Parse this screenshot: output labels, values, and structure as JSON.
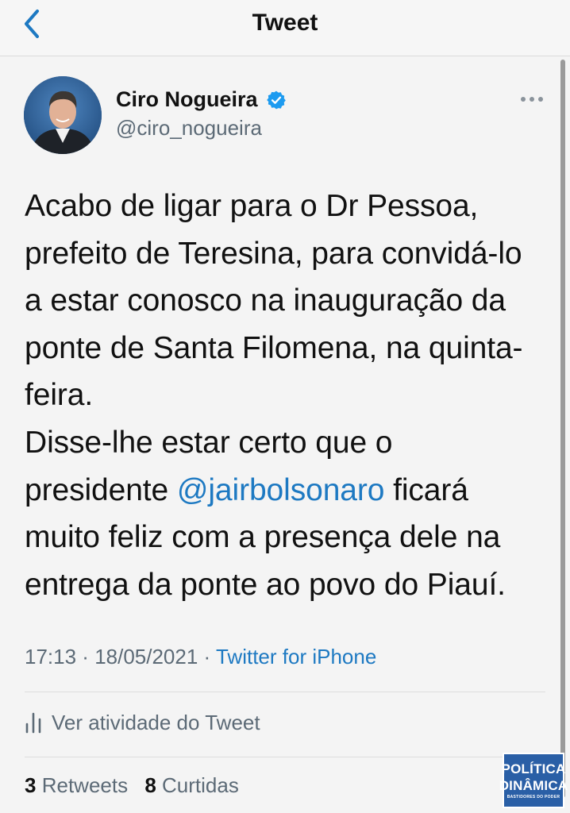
{
  "header": {
    "title": "Tweet"
  },
  "author": {
    "name": "Ciro Nogueira",
    "handle": "@ciro_nogueira"
  },
  "tweet": {
    "lines": [
      "Acabo de ligar para o Dr Pessoa,",
      "prefeito de Teresina, para convidá-lo",
      "a estar conosco na inauguração da",
      "ponte de Santa Filomena, na quinta-",
      "feira.",
      "Disse-lhe estar certo que o"
    ],
    "mention_prefix": "presidente ",
    "mention": "@jairbolsonaro",
    "mention_suffix": " ficará",
    "lines_after": [
      "muito feliz com a presença dele na",
      "entrega da ponte ao povo do Piauí."
    ]
  },
  "meta": {
    "time": "17:13",
    "separator": " · ",
    "date": "18/05/2021",
    "source": "Twitter for iPhone"
  },
  "activity": {
    "label": "Ver atividade do Tweet"
  },
  "stats": {
    "retweets_count": "3",
    "retweets_label": "Retweets",
    "likes_count": "8",
    "likes_label": "Curtidas"
  },
  "watermark": {
    "line1": "POLÍTICA",
    "line2": "DINÂMICA",
    "line3": "BASTIDORES DO PODER"
  },
  "colors": {
    "accent": "#1d79c2",
    "muted": "#5c6a76",
    "verified": "#1d9bf0"
  }
}
